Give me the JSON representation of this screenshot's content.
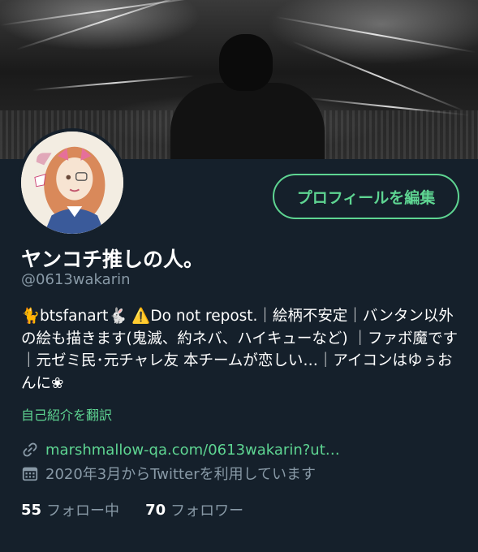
{
  "profile": {
    "display_name": "ヤンコチ推しの人。",
    "handle": "@0613wakarin",
    "bio": "🐈btsfanart🐇 ⚠️Do not repost.｜絵柄不安定｜バンタン以外の絵も描きます(鬼滅、約ネバ、ハイキューなど) ｜ファボ魔です｜元ゼミ民･元チャレ友 本チームが恋しい…｜アイコンはゆぅおんに❀",
    "translate_label": "自己紹介を翻訳",
    "link": "marshmallow-qa.com/0613wakarin?ut…",
    "joined": "2020年3月からTwitterを利用しています",
    "following_count": "55",
    "following_label": "フォロー中",
    "followers_count": "70",
    "followers_label": "フォロワー"
  },
  "actions": {
    "edit_profile_label": "プロフィールを編集"
  },
  "icons": {
    "link": "link-icon",
    "calendar": "calendar-icon"
  },
  "colors": {
    "background": "#15202b",
    "accent": "#5ed592",
    "secondary_text": "#8899a6"
  }
}
